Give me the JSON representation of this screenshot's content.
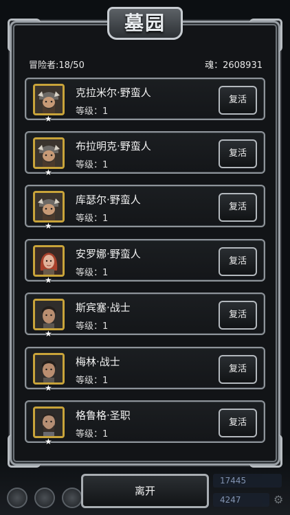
{
  "title": "墓园",
  "header": {
    "adventurers_label": "冒险者:18/50",
    "soul_label": "魂：2608931"
  },
  "heroes": [
    {
      "name": "克拉米尔·野蛮人",
      "level": "等级：1",
      "revive": "复活",
      "portrait": "bearded-helmet-warrior"
    },
    {
      "name": "布拉明克·野蛮人",
      "level": "等级：1",
      "revive": "复活",
      "portrait": "bearded-helmet-warrior"
    },
    {
      "name": "库瑟尔·野蛮人",
      "level": "等级：1",
      "revive": "复活",
      "portrait": "bearded-helmet-warrior"
    },
    {
      "name": "安罗娜·野蛮人",
      "level": "等级：1",
      "revive": "复活",
      "portrait": "red-haired-woman"
    },
    {
      "name": "斯宾塞·战士",
      "level": "等级：1",
      "revive": "复活",
      "portrait": "dark-haired-man"
    },
    {
      "name": "梅林·战士",
      "level": "等级：1",
      "revive": "复活",
      "portrait": "dark-haired-man"
    },
    {
      "name": "格鲁格·圣职",
      "level": "等级：1",
      "revive": "复活",
      "portrait": "bearded-priest"
    }
  ],
  "leave_button": "离开",
  "background_values": {
    "resource_1": "17445",
    "resource_2": "4247"
  }
}
